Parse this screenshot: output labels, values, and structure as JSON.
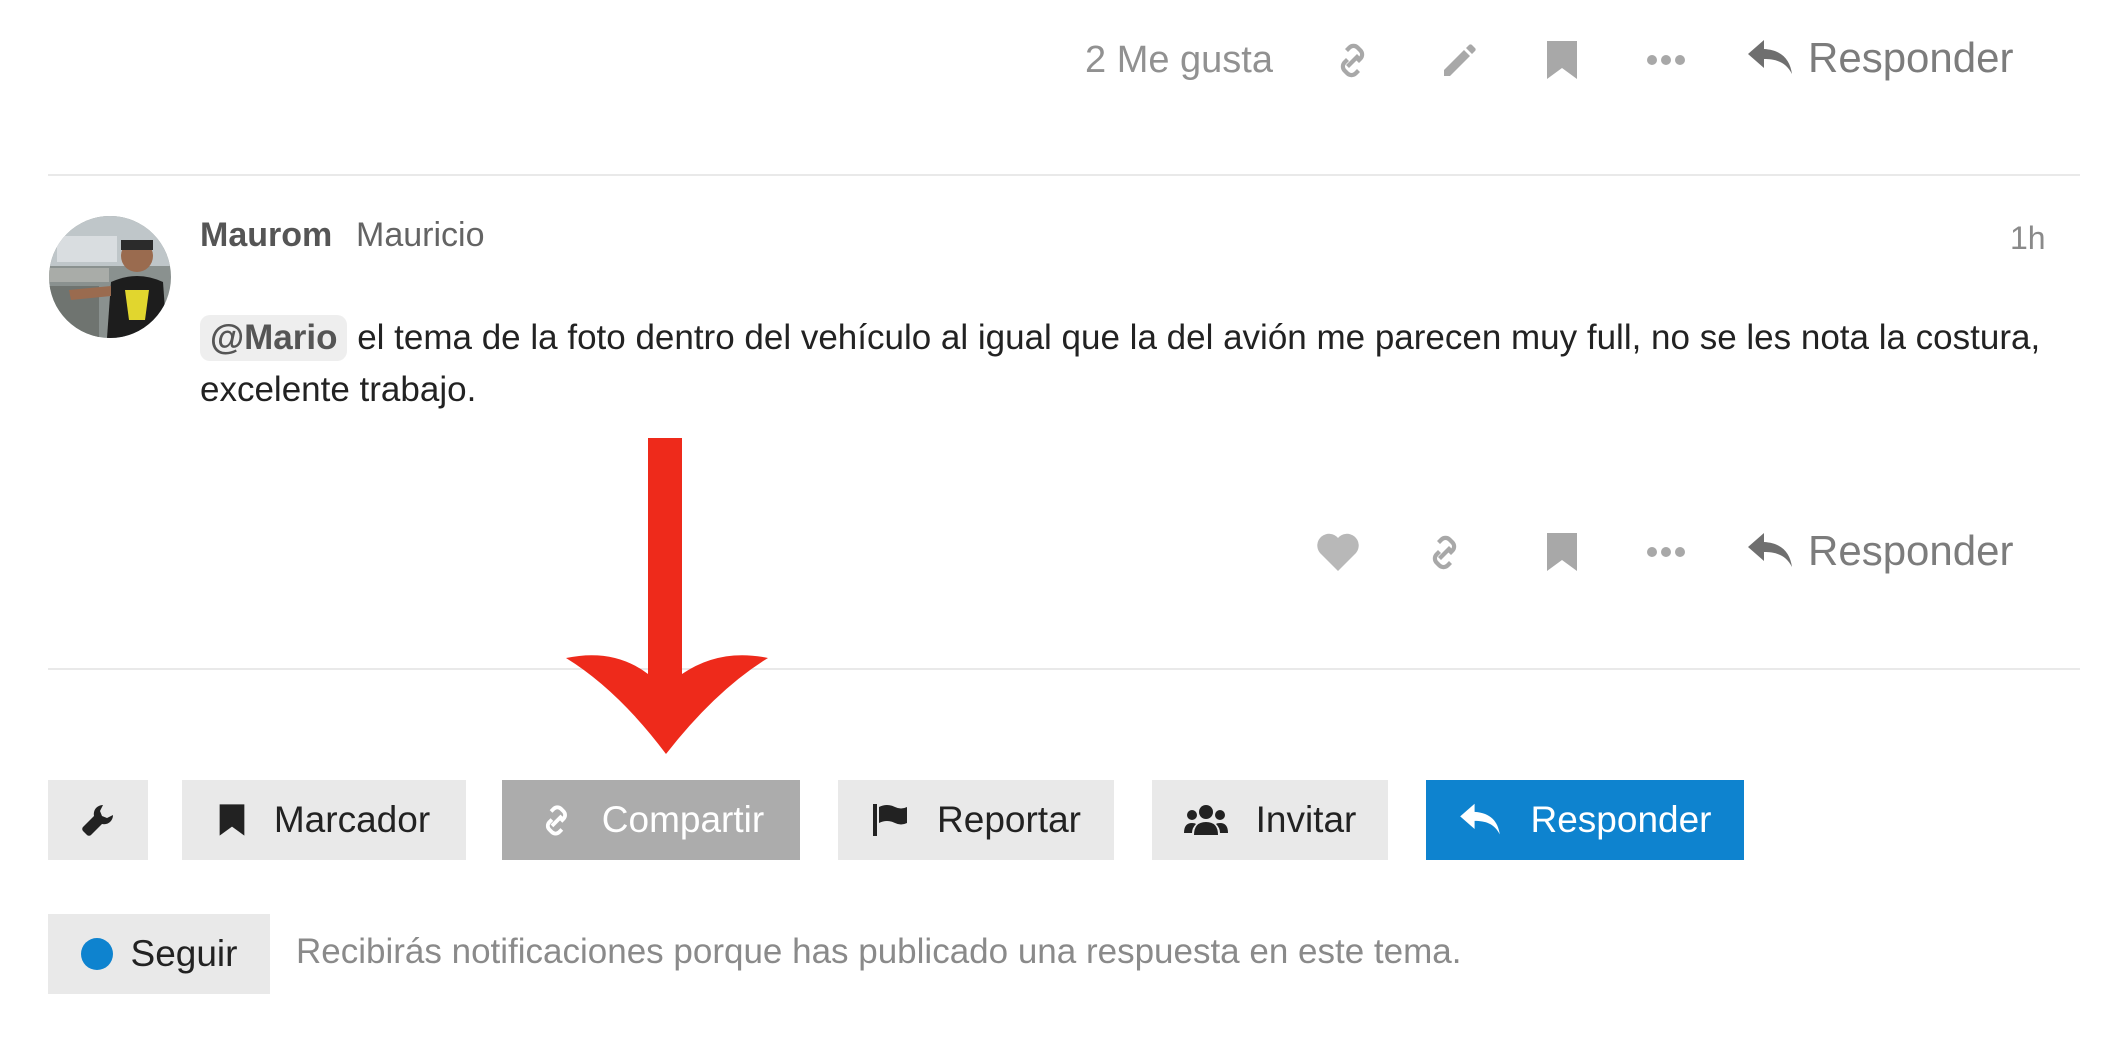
{
  "top_post": {
    "likes_label": "2 Me gusta",
    "icons": [
      "link-icon",
      "pencil-icon",
      "bookmark-icon",
      "more-icon"
    ],
    "reply_label": "Responder"
  },
  "post": {
    "username": "Maurom",
    "fullname": "Mauricio",
    "time": "1h",
    "mention": "@Mario",
    "body": "el tema de la foto dentro del vehículo al igual que la del avión me parecen muy full, no se les nota la costura, excelente trabajo.",
    "actions": {
      "icons": [
        "heart-icon",
        "link-icon",
        "bookmark-icon",
        "more-icon"
      ],
      "reply_label": "Responder"
    }
  },
  "footer": {
    "buttons": {
      "admin_icon": "wrench-icon",
      "bookmark": "Marcador",
      "share": "Compartir",
      "report": "Reportar",
      "invite": "Invitar",
      "reply": "Responder"
    },
    "follow_label": "Seguir",
    "notification_text": "Recibirás notificaciones porque has publicado una respuesta en este tema."
  },
  "colors": {
    "primary": "#0e83cf",
    "button_bg": "#e9e9e9",
    "share_active": "#acacac",
    "annotation_arrow": "#ee2a1b"
  }
}
